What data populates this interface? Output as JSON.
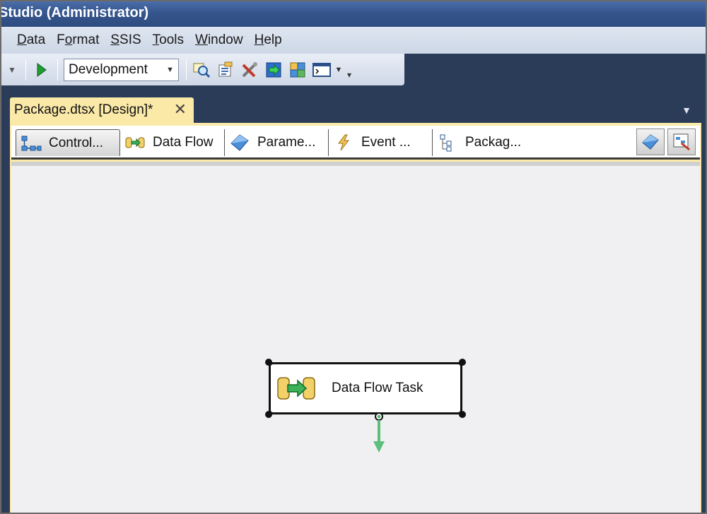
{
  "window": {
    "title": "Studio (Administrator)"
  },
  "menu": {
    "items": [
      {
        "label": "Data",
        "u": "D",
        "rest": "ata"
      },
      {
        "label": "Format",
        "pre": "F",
        "u": "o",
        "rest": "rmat"
      },
      {
        "label": "SSIS",
        "u": "S",
        "rest": "SIS"
      },
      {
        "label": "Tools",
        "u": "T",
        "rest": "ools"
      },
      {
        "label": "Window",
        "u": "W",
        "rest": "indow"
      },
      {
        "label": "Help",
        "u": "H",
        "rest": "elp"
      }
    ]
  },
  "toolbar": {
    "configuration": "Development",
    "icons": [
      "find-icon",
      "properties-icon",
      "tools-icon",
      "import-icon",
      "deploy-icon",
      "command-window-icon"
    ]
  },
  "document": {
    "tab_label": "Package.dtsx [Design]*"
  },
  "designer": {
    "tabs": [
      {
        "label": "Control...",
        "icon": "control-flow-icon",
        "active": true
      },
      {
        "label": "Data Flow",
        "icon": "data-flow-icon",
        "active": false
      },
      {
        "label": "Parame...",
        "icon": "parameters-icon",
        "active": false
      },
      {
        "label": "Event ...",
        "icon": "event-handlers-icon",
        "active": false
      },
      {
        "label": "Packag...",
        "icon": "package-explorer-icon",
        "active": false
      }
    ]
  },
  "canvas": {
    "task": {
      "label": "Data Flow Task",
      "icon": "data-flow-task-icon"
    }
  },
  "colors": {
    "titlebar": "#35558c",
    "tab_highlight": "#fbe9a8",
    "canvas": "#f0f0f2",
    "connector": "#5cbf7a"
  }
}
